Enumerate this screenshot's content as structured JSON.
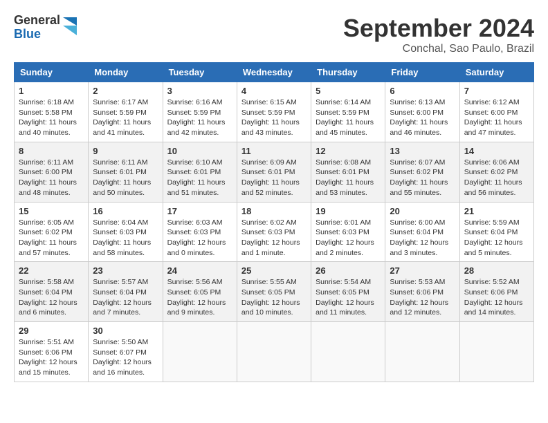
{
  "header": {
    "logo_line1": "General",
    "logo_line2": "Blue",
    "month_title": "September 2024",
    "location": "Conchal, Sao Paulo, Brazil"
  },
  "weekdays": [
    "Sunday",
    "Monday",
    "Tuesday",
    "Wednesday",
    "Thursday",
    "Friday",
    "Saturday"
  ],
  "weeks": [
    [
      {
        "day": "1",
        "sunrise": "6:18 AM",
        "sunset": "5:58 PM",
        "daylight": "11 hours and 40 minutes."
      },
      {
        "day": "2",
        "sunrise": "6:17 AM",
        "sunset": "5:59 PM",
        "daylight": "11 hours and 41 minutes."
      },
      {
        "day": "3",
        "sunrise": "6:16 AM",
        "sunset": "5:59 PM",
        "daylight": "11 hours and 42 minutes."
      },
      {
        "day": "4",
        "sunrise": "6:15 AM",
        "sunset": "5:59 PM",
        "daylight": "11 hours and 43 minutes."
      },
      {
        "day": "5",
        "sunrise": "6:14 AM",
        "sunset": "5:59 PM",
        "daylight": "11 hours and 45 minutes."
      },
      {
        "day": "6",
        "sunrise": "6:13 AM",
        "sunset": "6:00 PM",
        "daylight": "11 hours and 46 minutes."
      },
      {
        "day": "7",
        "sunrise": "6:12 AM",
        "sunset": "6:00 PM",
        "daylight": "11 hours and 47 minutes."
      }
    ],
    [
      {
        "day": "8",
        "sunrise": "6:11 AM",
        "sunset": "6:00 PM",
        "daylight": "11 hours and 48 minutes."
      },
      {
        "day": "9",
        "sunrise": "6:11 AM",
        "sunset": "6:01 PM",
        "daylight": "11 hours and 50 minutes."
      },
      {
        "day": "10",
        "sunrise": "6:10 AM",
        "sunset": "6:01 PM",
        "daylight": "11 hours and 51 minutes."
      },
      {
        "day": "11",
        "sunrise": "6:09 AM",
        "sunset": "6:01 PM",
        "daylight": "11 hours and 52 minutes."
      },
      {
        "day": "12",
        "sunrise": "6:08 AM",
        "sunset": "6:01 PM",
        "daylight": "11 hours and 53 minutes."
      },
      {
        "day": "13",
        "sunrise": "6:07 AM",
        "sunset": "6:02 PM",
        "daylight": "11 hours and 55 minutes."
      },
      {
        "day": "14",
        "sunrise": "6:06 AM",
        "sunset": "6:02 PM",
        "daylight": "11 hours and 56 minutes."
      }
    ],
    [
      {
        "day": "15",
        "sunrise": "6:05 AM",
        "sunset": "6:02 PM",
        "daylight": "11 hours and 57 minutes."
      },
      {
        "day": "16",
        "sunrise": "6:04 AM",
        "sunset": "6:03 PM",
        "daylight": "11 hours and 58 minutes."
      },
      {
        "day": "17",
        "sunrise": "6:03 AM",
        "sunset": "6:03 PM",
        "daylight": "12 hours and 0 minutes."
      },
      {
        "day": "18",
        "sunrise": "6:02 AM",
        "sunset": "6:03 PM",
        "daylight": "12 hours and 1 minute."
      },
      {
        "day": "19",
        "sunrise": "6:01 AM",
        "sunset": "6:03 PM",
        "daylight": "12 hours and 2 minutes."
      },
      {
        "day": "20",
        "sunrise": "6:00 AM",
        "sunset": "6:04 PM",
        "daylight": "12 hours and 3 minutes."
      },
      {
        "day": "21",
        "sunrise": "5:59 AM",
        "sunset": "6:04 PM",
        "daylight": "12 hours and 5 minutes."
      }
    ],
    [
      {
        "day": "22",
        "sunrise": "5:58 AM",
        "sunset": "6:04 PM",
        "daylight": "12 hours and 6 minutes."
      },
      {
        "day": "23",
        "sunrise": "5:57 AM",
        "sunset": "6:04 PM",
        "daylight": "12 hours and 7 minutes."
      },
      {
        "day": "24",
        "sunrise": "5:56 AM",
        "sunset": "6:05 PM",
        "daylight": "12 hours and 9 minutes."
      },
      {
        "day": "25",
        "sunrise": "5:55 AM",
        "sunset": "6:05 PM",
        "daylight": "12 hours and 10 minutes."
      },
      {
        "day": "26",
        "sunrise": "5:54 AM",
        "sunset": "6:05 PM",
        "daylight": "12 hours and 11 minutes."
      },
      {
        "day": "27",
        "sunrise": "5:53 AM",
        "sunset": "6:06 PM",
        "daylight": "12 hours and 12 minutes."
      },
      {
        "day": "28",
        "sunrise": "5:52 AM",
        "sunset": "6:06 PM",
        "daylight": "12 hours and 14 minutes."
      }
    ],
    [
      {
        "day": "29",
        "sunrise": "5:51 AM",
        "sunset": "6:06 PM",
        "daylight": "12 hours and 15 minutes."
      },
      {
        "day": "30",
        "sunrise": "5:50 AM",
        "sunset": "6:07 PM",
        "daylight": "12 hours and 16 minutes."
      },
      null,
      null,
      null,
      null,
      null
    ]
  ],
  "labels": {
    "sunrise": "Sunrise: ",
    "sunset": "Sunset: ",
    "daylight": "Daylight: "
  }
}
